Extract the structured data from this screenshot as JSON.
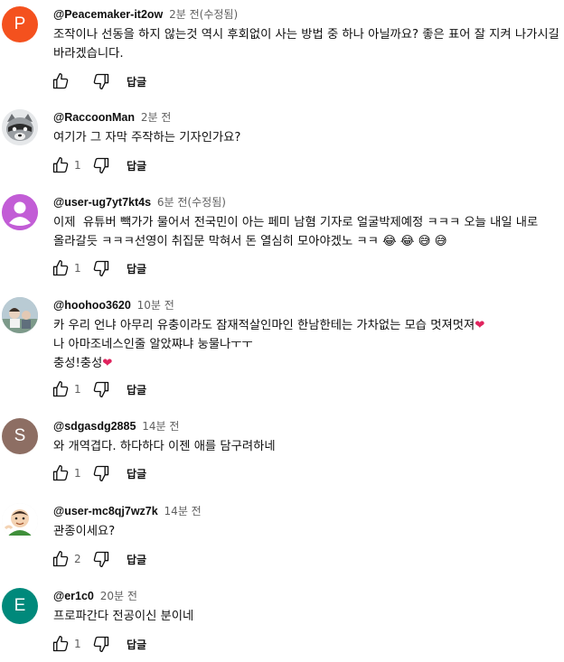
{
  "labels": {
    "reply": "답글"
  },
  "comments": [
    {
      "author": "@Peacemaker-it2ow",
      "time": "2분 전(수정됨)",
      "text": "조작이나 선동을 하지 않는것 역시 후회없이 사는 방법 중 하나 아닐까요? 좋은 표어 잘 지켜 나가시길 바라겠습니다.",
      "likes": "",
      "avatar_letter": "P",
      "avatar_color": "#f4511e"
    },
    {
      "author": "@RaccoonMan",
      "time": "2분 전",
      "text": "여기가 그 자막 주작하는 기자인가요?",
      "likes": "1",
      "avatar_letter": "",
      "avatar_color": "#7a7f84"
    },
    {
      "author": "@user-ug7yt7kt4s",
      "time": "6분 전(수정됨)",
      "text": "이제  유튜버 빽가가 물어서 전국민이 아는 페미 남혐 기자로 얼굴박제예정 ㅋㅋㅋ 오늘 내일 내로 올라갈듯 ㅋㅋㅋ선영이 취집문 막혀서 돈 열심히 모아야겠노 ㅋㅋ 😂 😂 😅 😅",
      "likes": "1",
      "avatar_letter": "",
      "avatar_color": "#c25dd6"
    },
    {
      "author": "@hoohoo3620",
      "time": "10분 전",
      "text_lines": [
        "카 우리 언냐 아무리 유충이라도 잠재적살인마인 한남한테는 가차없는 모습 멋져멋져",
        "나 아마조네스인줄 알았쨔냐 눙물나ㅜㅜ",
        "충성!충성"
      ],
      "likes": "1",
      "avatar_letter": "",
      "avatar_color": "#8fa9b8"
    },
    {
      "author": "@sdgasdg2885",
      "time": "14분 전",
      "text": "와 개역겹다. 하다하다 이젠 애를 담구려하네",
      "likes": "1",
      "avatar_letter": "S",
      "avatar_color": "#8d6e63"
    },
    {
      "author": "@user-mc8qj7wz7k",
      "time": "14분 전",
      "text": "관종이세요?",
      "likes": "2",
      "avatar_letter": "",
      "avatar_color": "#f3f3f3"
    },
    {
      "author": "@er1c0",
      "time": "20분 전",
      "text": "프로파간다 전공이신 분이네",
      "likes": "1",
      "avatar_letter": "E",
      "avatar_color": "#00897b"
    }
  ]
}
